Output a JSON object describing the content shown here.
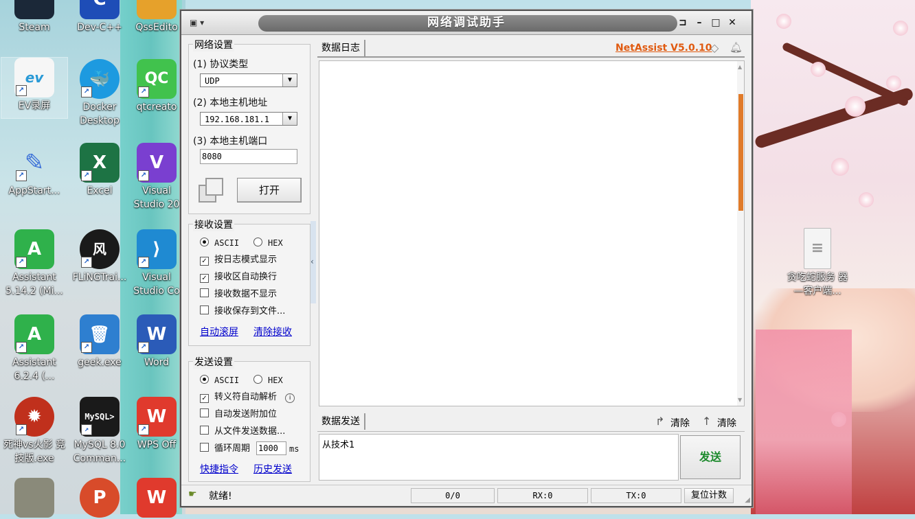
{
  "desktop_icons": [
    {
      "label": "Steam",
      "color": "#1b2838",
      "glyph": "S"
    },
    {
      "label": "Dev-C++",
      "color": "#1e4db7",
      "glyph": "C"
    },
    {
      "label": "QssEdito",
      "color": "#e6a12b",
      "glyph": "Q"
    },
    {
      "label": "EV录屏",
      "color": "#ffffff",
      "glyph": "ev"
    },
    {
      "label": "Docker Desktop",
      "color": "#1d9ae0",
      "glyph": "🐳"
    },
    {
      "label": "qtcreato",
      "color": "#41c24d",
      "glyph": "QC"
    },
    {
      "label": "AppStart...",
      "color": "#3a6fd8",
      "glyph": "✎"
    },
    {
      "label": "Excel",
      "color": "#1d7344",
      "glyph": "X"
    },
    {
      "label": "Visual Studio 20",
      "color": "#7a3fd0",
      "glyph": "V"
    },
    {
      "label": "Assistant 5.14.2 (Mi...",
      "color": "#2fb14b",
      "glyph": "A"
    },
    {
      "label": "FLiNGTrai...",
      "color": "#1a1a1a",
      "glyph": "风"
    },
    {
      "label": "Visual Studio Co",
      "color": "#1f8ad2",
      "glyph": "⟩"
    },
    {
      "label": "Assistant 6.2.4 (...",
      "color": "#2fb14b",
      "glyph": "A"
    },
    {
      "label": "geek.exe",
      "color": "#2e7fd0",
      "glyph": "🗑"
    },
    {
      "label": "Word",
      "color": "#2b5bb8",
      "glyph": "W"
    },
    {
      "label": "死神vs火影 竞技版.exe",
      "color": "#c0301c",
      "glyph": "✹"
    },
    {
      "label": "MySQL 8.0 Comman...",
      "color": "#1a1a1a",
      "glyph": "MySQL>"
    },
    {
      "label": "WPS Off",
      "color": "#e03a2d",
      "glyph": "W"
    },
    {
      "label": "",
      "color": "#8a8a7a",
      "glyph": ""
    },
    {
      "label": "",
      "color": "#d84b2a",
      "glyph": "P"
    },
    {
      "label": "",
      "color": "#e03a2d",
      "glyph": "W"
    },
    {
      "label": "贪吃蛇服务 器—客户端...",
      "color": "#f4f4f4",
      "glyph": "≡"
    }
  ],
  "window": {
    "title": "网络调试助手",
    "controls": {
      "pin": "⊐",
      "minimize": "–",
      "maximize": "□",
      "close": "✕"
    }
  },
  "network": {
    "title": "网络设置",
    "protocol_label": "(1) 协议类型",
    "protocol_value": "UDP",
    "host_label": "(2) 本地主机地址",
    "host_value": "192.168.181.1",
    "port_label": "(3) 本地主机端口",
    "port_value": "8080",
    "open_button": "打开"
  },
  "receive": {
    "title": "接收设置",
    "mode_ascii": "ASCII",
    "mode_hex": "HEX",
    "options": [
      {
        "label": "按日志模式显示",
        "checked": true
      },
      {
        "label": "接收区自动换行",
        "checked": true
      },
      {
        "label": "接收数据不显示",
        "checked": false
      },
      {
        "label": "接收保存到文件...",
        "checked": false
      }
    ],
    "link_autoscroll": "自动滚屏",
    "link_clear": "清除接收"
  },
  "send": {
    "title": "发送设置",
    "mode_ascii": "ASCII",
    "mode_hex": "HEX",
    "opt_escape": "转义符自动解析",
    "opt_append": "自动发送附加位",
    "opt_file": "从文件发送数据...",
    "opt_cycle": "循环周期",
    "cycle_value": "1000",
    "cycle_unit": "ms",
    "link_shortcut": "快捷指令",
    "link_history": "历史发送"
  },
  "log": {
    "tab": "数据日志",
    "brand": "NetAssist V5.0.10"
  },
  "sendpanel": {
    "tab": "数据发送",
    "clear1": "清除",
    "clear2": "清除",
    "content": "从技术1",
    "send_button": "发送"
  },
  "status": {
    "ready": "就绪!",
    "counter": "0/0",
    "rx": "RX:0",
    "tx": "TX:0",
    "reset": "复位计数"
  }
}
